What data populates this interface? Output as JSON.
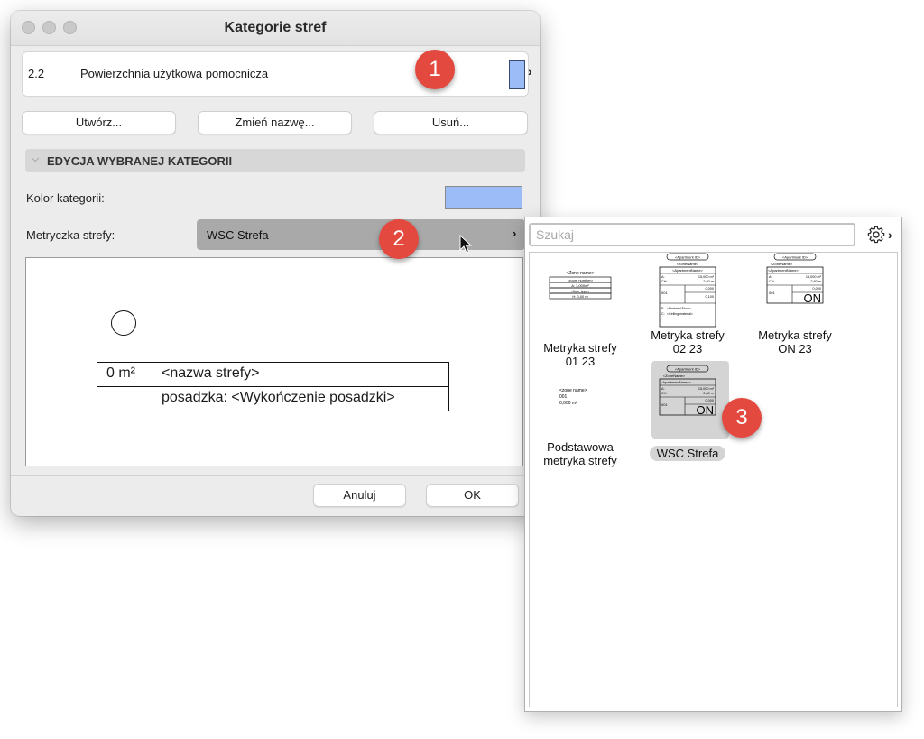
{
  "window": {
    "title": "Kategorie stref"
  },
  "category": {
    "code": "2.2",
    "name": "Powierzchnia użytkowa pomocnicza",
    "color": "#9bbcf7"
  },
  "buttons": {
    "create": "Utwórz...",
    "rename": "Zmień nazwę...",
    "delete": "Usuń...",
    "cancel": "Anuluj",
    "ok": "OK"
  },
  "section": {
    "title": "EDYCJA WYBRANEJ KATEGORII"
  },
  "fields": {
    "color_label": "Kolor kategorii:",
    "metric_label": "Metryczka strefy:",
    "metric_value": "WSC Strefa"
  },
  "preview": {
    "area": "0 m²",
    "name": "<nazwa strefy>",
    "floor": "posadzka: <Wykończenie posadzki>"
  },
  "markers": [
    "1",
    "2",
    "3"
  ],
  "library": {
    "search_placeholder": "Szukaj",
    "items": [
      {
        "line1": "Metryka strefy",
        "line2": "01 23"
      },
      {
        "line1": "Metryka strefy",
        "line2": "02 23"
      },
      {
        "line1": "Metryka strefy",
        "line2": "ON 23"
      },
      {
        "line1": "Podstawowa",
        "line2": "metryka strefy"
      },
      {
        "line1": "WSC Strefa",
        "line2": "",
        "selected": true
      }
    ]
  },
  "thumb_text": {
    "zone_name": "<Zone name>",
    "zone_name_lower": "<zone name>",
    "room_number": "<room number>",
    "floor_type": "<floor type>",
    "apartment_id": "<Apartment ID>",
    "zone_name_tag": "<ZoneName>",
    "apartment_name": "<ApartmentName>",
    "area_value": "15,000 m²",
    "height_value": "2,80 m",
    "code_001": "001",
    "small_value": "0,000",
    "small_value_2": "0,100",
    "finished_floor": "<Finished Floor>",
    "ceiling_material": "<Ceiling material>",
    "on": "ON",
    "basic_area": "0,000 m²",
    "a_label": "A:",
    "ch_label": "CH:",
    "a_small": "A: 3,000m²",
    "h_small": "H: 0,00 m",
    "f_label": "F:",
    "c_label": "C:"
  },
  "colors": {
    "accent_marker": "#e3493f",
    "swatch": "#9bbcf7",
    "selected_tile": "#d4d4d4"
  },
  "icons": {
    "gear": "gear-icon",
    "chevron": "chevron-right-icon",
    "cursor": "cursor-icon"
  }
}
